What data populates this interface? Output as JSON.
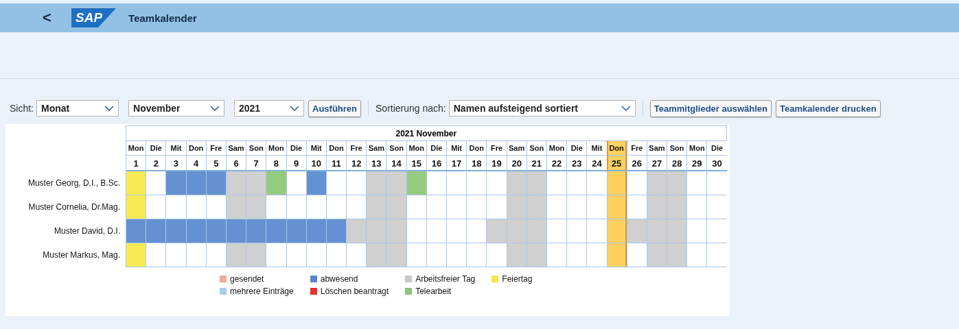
{
  "header": {
    "back": "<",
    "logo": "SAP",
    "title": "Teamkalender"
  },
  "toolbar": {
    "view_label": "Sicht:",
    "view": "Monat",
    "month": "November",
    "year": "2021",
    "run_button": "Ausführen",
    "sort_label": "Sortierung nach:",
    "sort": "Namen aufsteigend sortiert",
    "buttons": [
      "Teammitglieder auswählen",
      "Teamkalender drucken"
    ]
  },
  "calendar": {
    "title": "2021 November",
    "days": [
      {
        "weekday": "Mon",
        "day": "1",
        "selected": false
      },
      {
        "weekday": "Die",
        "day": "2",
        "selected": false
      },
      {
        "weekday": "Mit",
        "day": "3",
        "selected": false
      },
      {
        "weekday": "Don",
        "day": "4",
        "selected": false
      },
      {
        "weekday": "Fre",
        "day": "5",
        "selected": false
      },
      {
        "weekday": "Sam",
        "day": "6",
        "selected": false
      },
      {
        "weekday": "Son",
        "day": "7",
        "selected": false
      },
      {
        "weekday": "Mon",
        "day": "8",
        "selected": false
      },
      {
        "weekday": "Die",
        "day": "9",
        "selected": false
      },
      {
        "weekday": "Mit",
        "day": "10",
        "selected": false
      },
      {
        "weekday": "Don",
        "day": "11",
        "selected": false
      },
      {
        "weekday": "Fre",
        "day": "12",
        "selected": false
      },
      {
        "weekday": "Sam",
        "day": "13",
        "selected": false
      },
      {
        "weekday": "Son",
        "day": "14",
        "selected": false
      },
      {
        "weekday": "Mon",
        "day": "15",
        "selected": false
      },
      {
        "weekday": "Die",
        "day": "16",
        "selected": false
      },
      {
        "weekday": "Mit",
        "day": "17",
        "selected": false
      },
      {
        "weekday": "Don",
        "day": "18",
        "selected": false
      },
      {
        "weekday": "Fre",
        "day": "19",
        "selected": false
      },
      {
        "weekday": "Sam",
        "day": "20",
        "selected": false
      },
      {
        "weekday": "Son",
        "day": "21",
        "selected": false
      },
      {
        "weekday": "Mon",
        "day": "22",
        "selected": false
      },
      {
        "weekday": "Die",
        "day": "23",
        "selected": false
      },
      {
        "weekday": "Mit",
        "day": "24",
        "selected": false
      },
      {
        "weekday": "Don",
        "day": "25",
        "selected": true
      },
      {
        "weekday": "Fre",
        "day": "26",
        "selected": false
      },
      {
        "weekday": "Sam",
        "day": "27",
        "selected": false
      },
      {
        "weekday": "Son",
        "day": "28",
        "selected": false
      },
      {
        "weekday": "Mon",
        "day": "29",
        "selected": false
      },
      {
        "weekday": "Die",
        "day": "30",
        "selected": false
      }
    ],
    "rows": [
      {
        "name": "Muster Georg, D.I., B.Sc.",
        "cells": [
          {
            "kind": "holiday"
          },
          {
            "kind": "free"
          },
          {
            "kind": "absent"
          },
          {
            "kind": "absent"
          },
          {
            "kind": "absent"
          },
          {
            "kind": "off"
          },
          {
            "kind": "off"
          },
          {
            "kind": "telework"
          },
          {
            "kind": "free"
          },
          {
            "kind": "absent"
          },
          {
            "kind": "free"
          },
          {
            "kind": "free"
          },
          {
            "kind": "off"
          },
          {
            "kind": "off"
          },
          {
            "kind": "telework"
          },
          {
            "kind": "free"
          },
          {
            "kind": "free"
          },
          {
            "kind": "free"
          },
          {
            "kind": "free"
          },
          {
            "kind": "off"
          },
          {
            "kind": "off"
          },
          {
            "kind": "free"
          },
          {
            "kind": "free"
          },
          {
            "kind": "free"
          },
          {
            "kind": "free"
          },
          {
            "kind": "free"
          },
          {
            "kind": "off"
          },
          {
            "kind": "off"
          },
          {
            "kind": "free"
          },
          {
            "kind": "free"
          }
        ]
      },
      {
        "name": "Muster Cornelia, Dr.Mag.",
        "cells": [
          {
            "kind": "holiday"
          },
          {
            "kind": "free"
          },
          {
            "kind": "free"
          },
          {
            "kind": "free"
          },
          {
            "kind": "free"
          },
          {
            "kind": "off"
          },
          {
            "kind": "off"
          },
          {
            "kind": "free"
          },
          {
            "kind": "free"
          },
          {
            "kind": "free"
          },
          {
            "kind": "free"
          },
          {
            "kind": "free"
          },
          {
            "kind": "off"
          },
          {
            "kind": "off"
          },
          {
            "kind": "free"
          },
          {
            "kind": "free"
          },
          {
            "kind": "free"
          },
          {
            "kind": "free"
          },
          {
            "kind": "free"
          },
          {
            "kind": "off"
          },
          {
            "kind": "off"
          },
          {
            "kind": "free"
          },
          {
            "kind": "free"
          },
          {
            "kind": "free"
          },
          {
            "kind": "free"
          },
          {
            "kind": "free"
          },
          {
            "kind": "off"
          },
          {
            "kind": "off"
          },
          {
            "kind": "free"
          },
          {
            "kind": "free"
          }
        ]
      },
      {
        "name": "Muster David, D.I.",
        "cells": [
          {
            "kind": "absent"
          },
          {
            "kind": "absent"
          },
          {
            "kind": "absent"
          },
          {
            "kind": "absent"
          },
          {
            "kind": "absent"
          },
          {
            "kind": "absent"
          },
          {
            "kind": "absent"
          },
          {
            "kind": "absent"
          },
          {
            "kind": "absent"
          },
          {
            "kind": "absent"
          },
          {
            "kind": "absent"
          },
          {
            "kind": "off"
          },
          {
            "kind": "off"
          },
          {
            "kind": "off"
          },
          {
            "kind": "free"
          },
          {
            "kind": "free"
          },
          {
            "kind": "free"
          },
          {
            "kind": "free"
          },
          {
            "kind": "off"
          },
          {
            "kind": "off"
          },
          {
            "kind": "off"
          },
          {
            "kind": "free"
          },
          {
            "kind": "free"
          },
          {
            "kind": "free"
          },
          {
            "kind": "free"
          },
          {
            "kind": "off"
          },
          {
            "kind": "off"
          },
          {
            "kind": "off"
          },
          {
            "kind": "free"
          },
          {
            "kind": "free"
          }
        ]
      },
      {
        "name": "Muster Markus, Mag.",
        "cells": [
          {
            "kind": "holiday"
          },
          {
            "kind": "free"
          },
          {
            "kind": "free"
          },
          {
            "kind": "free"
          },
          {
            "kind": "free"
          },
          {
            "kind": "off"
          },
          {
            "kind": "off"
          },
          {
            "kind": "free"
          },
          {
            "kind": "free"
          },
          {
            "kind": "free"
          },
          {
            "kind": "free"
          },
          {
            "kind": "free"
          },
          {
            "kind": "off"
          },
          {
            "kind": "off"
          },
          {
            "kind": "free"
          },
          {
            "kind": "free"
          },
          {
            "kind": "free"
          },
          {
            "kind": "free"
          },
          {
            "kind": "free"
          },
          {
            "kind": "off"
          },
          {
            "kind": "off"
          },
          {
            "kind": "free"
          },
          {
            "kind": "free"
          },
          {
            "kind": "free"
          },
          {
            "kind": "free"
          },
          {
            "kind": "free"
          },
          {
            "kind": "off"
          },
          {
            "kind": "off"
          },
          {
            "kind": "free"
          },
          {
            "kind": "free"
          }
        ]
      }
    ],
    "legend": [
      {
        "label": "gesendet",
        "color": "#f0a8a0"
      },
      {
        "label": "abwesend",
        "color": "#5b87c9"
      },
      {
        "label": "Arbeitsfreier Tag",
        "color": "#c8c8c8"
      },
      {
        "label": "Feiertag",
        "color": "#f5e44a"
      },
      {
        "label": "mehrere Einträge",
        "color": "#a9cdee"
      },
      {
        "label": "Löschen beantragt",
        "color": "#e53030"
      },
      {
        "label": "Telearbeit",
        "color": "#8cc57a"
      }
    ]
  }
}
